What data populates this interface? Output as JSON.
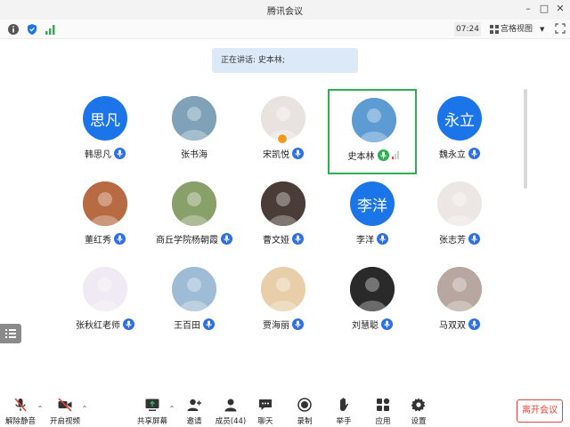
{
  "window": {
    "title": "腾讯会议"
  },
  "toolbar": {
    "timer": "07:24",
    "view_label": "宫格视图"
  },
  "speaking": {
    "text": "正在讲话: 史本林;"
  },
  "participants": [
    {
      "name": "韩思凡",
      "avatar_text": "思凡",
      "avatar_color": "#1c75e8",
      "mic": "blue"
    },
    {
      "name": "张书海",
      "avatar_text": "",
      "avatar_color": "#7fa2b8",
      "mic": "none"
    },
    {
      "name": "宋凯悦",
      "avatar_text": "",
      "avatar_color": "#e9e3df",
      "mic": "blue"
    },
    {
      "name": "史本林",
      "avatar_text": "",
      "avatar_color": "#5d9bd3",
      "mic": "green"
    },
    {
      "name": "魏永立",
      "avatar_text": "永立",
      "avatar_color": "#1c75e8",
      "mic": "blue"
    },
    {
      "name": "董红秀",
      "avatar_text": "",
      "avatar_color": "#b86a43",
      "mic": "blue"
    },
    {
      "name": "商丘学院杨朝霞",
      "avatar_text": "",
      "avatar_color": "#8aa06a",
      "mic": "blue"
    },
    {
      "name": "曹文娅",
      "avatar_text": "",
      "avatar_color": "#4a3d37",
      "mic": "blue"
    },
    {
      "name": "李洋",
      "avatar_text": "李洋",
      "avatar_color": "#1c75e8",
      "mic": "blue"
    },
    {
      "name": "张志芳",
      "avatar_text": "",
      "avatar_color": "#ece7e4",
      "mic": "blue"
    },
    {
      "name": "张秋红老师",
      "avatar_text": "",
      "avatar_color": "#efeaf3",
      "mic": "blue"
    },
    {
      "name": "王百田",
      "avatar_text": "",
      "avatar_color": "#9fbcd6",
      "mic": "blue"
    },
    {
      "name": "贾海丽",
      "avatar_text": "",
      "avatar_color": "#e8cfa9",
      "mic": "blue"
    },
    {
      "name": "刘慧聪",
      "avatar_text": "",
      "avatar_color": "#2a2a2a",
      "mic": "blue"
    },
    {
      "name": "马双双",
      "avatar_text": "",
      "avatar_color": "#b8a7a0",
      "mic": "blue"
    }
  ],
  "bottom": {
    "unmute": "解除静音",
    "video": "开启视频",
    "share": "共享屏幕",
    "invite": "邀请",
    "members": "成员(44)",
    "chat": "聊天",
    "record": "录制",
    "raise_hand": "举手",
    "apps": "应用",
    "settings": "设置",
    "leave": "离开会议"
  },
  "colors": {
    "accent": "#1c75e8",
    "active": "#2fae54",
    "leave": "#e3443b"
  }
}
